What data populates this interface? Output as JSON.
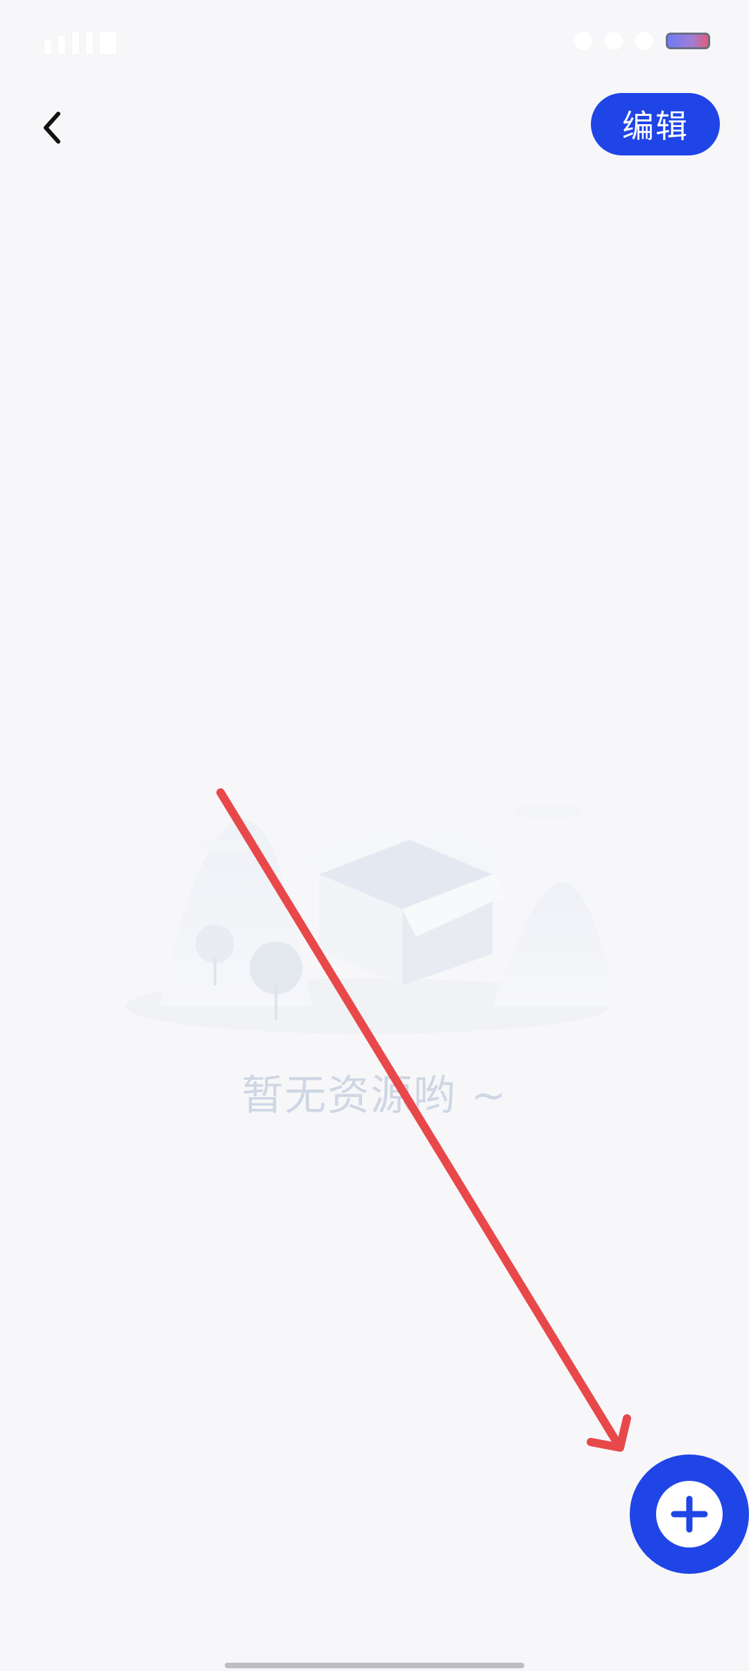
{
  "status_bar": {
    "battery_icon": "battery-icon"
  },
  "header": {
    "back_icon": "chevron-left-icon",
    "edit_label": "编辑"
  },
  "empty_state": {
    "illustration_icon": "empty-box-illustration",
    "message": "暂无资源哟 ~"
  },
  "fab": {
    "icon": "plus-icon"
  },
  "annotation": {
    "type": "arrow",
    "color": "#e8484a"
  },
  "colors": {
    "accent": "#1f45e6",
    "background": "#f7f7f9",
    "empty_text": "#cfd6e4"
  }
}
